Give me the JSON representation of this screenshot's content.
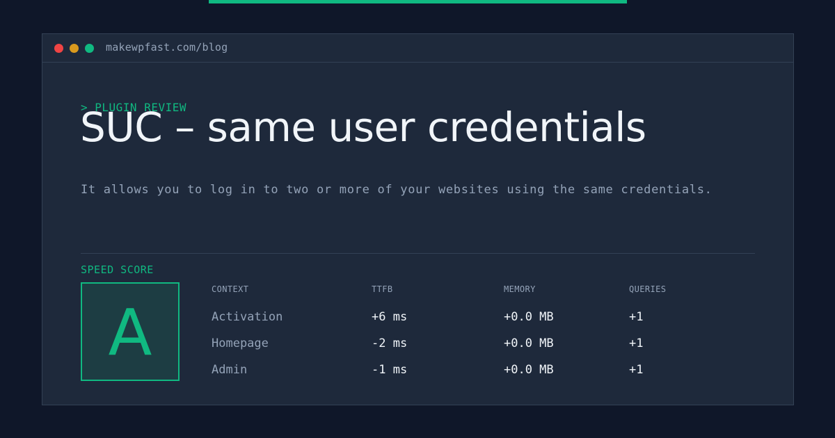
{
  "window": {
    "url": "makewpfast.com/blog"
  },
  "post": {
    "kicker": "> PLUGIN REVIEW",
    "title": "SUC – same user credentials",
    "description": "It allows you to log in to two or more of your websites using the same credentials."
  },
  "score": {
    "label": "SPEED SCORE",
    "grade": "A"
  },
  "table": {
    "headers": [
      "CONTEXT",
      "TTFB",
      "MEMORY",
      "QUERIES"
    ],
    "rows": [
      [
        "Activation",
        "+6 ms",
        "+0.0 MB",
        "+1"
      ],
      [
        "Homepage",
        "-2 ms",
        "+0.0 MB",
        "+1"
      ],
      [
        "Admin",
        "-1 ms",
        "+0.0 MB",
        "+1"
      ]
    ]
  },
  "colors": {
    "background": "#0f1729",
    "panel": "#1e293b",
    "accent": "#10b981",
    "muted_text": "#94a3b8",
    "bright_text": "#f1f5f9"
  }
}
